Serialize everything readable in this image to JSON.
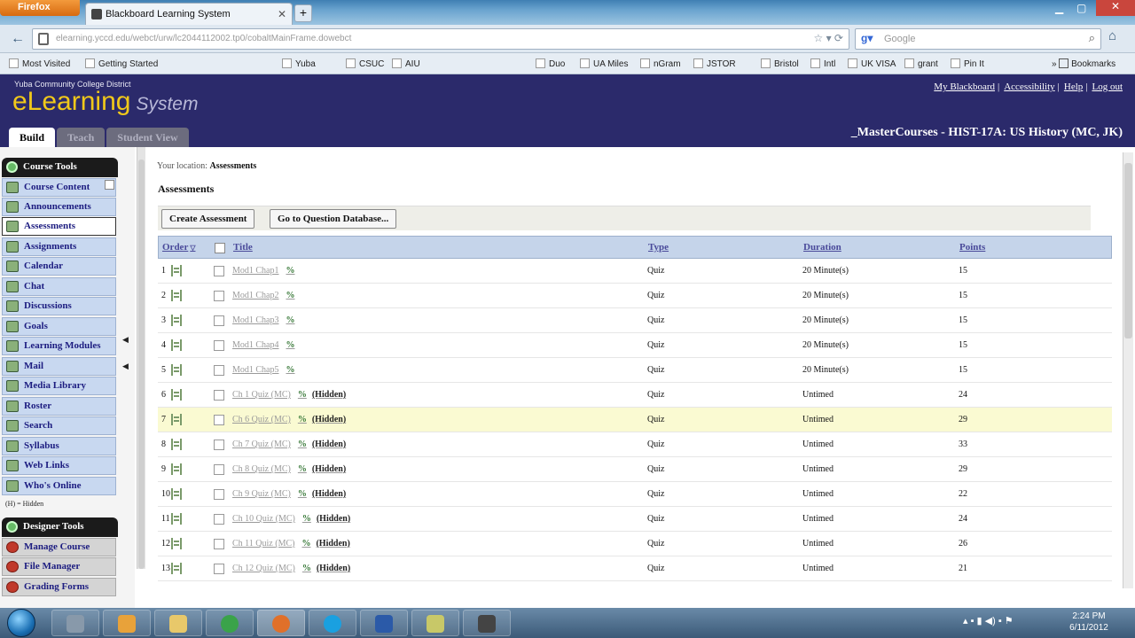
{
  "browser": {
    "firefox_button": "Firefox",
    "tab_title": "Blackboard Learning System",
    "url": "elearning.yccd.edu/webct/urw/lc2044112002.tp0/cobaltMainFrame.dowebct",
    "search_placeholder": "Google",
    "bookmarks": [
      "Most Visited",
      "Getting Started",
      "Yuba",
      "CSUC",
      "AIU",
      "Duo",
      "UA Miles",
      "nGram",
      "JSTOR",
      "Bristol",
      "Intl",
      "UK VISA",
      "grant",
      "Pin It"
    ],
    "bookmarks_menu": "Bookmarks"
  },
  "lms": {
    "district": "Yuba Community College District",
    "logo_main": "eLearning",
    "logo_sub": "System",
    "top_links": [
      "My Blackboard",
      "Accessibility",
      "Help",
      "Log out"
    ],
    "tabs": [
      "Build",
      "Teach",
      "Student View"
    ],
    "active_tab": "Build",
    "course_title": "_MasterCourses - HIST-17A: US History (MC, JK)"
  },
  "sidebar": {
    "course_tools_title": "Course Tools",
    "course_tools": [
      "Course Content",
      "Announcements",
      "Assessments",
      "Assignments",
      "Calendar",
      "Chat",
      "Discussions",
      "Goals",
      "Learning Modules",
      "Mail",
      "Media Library",
      "Roster",
      "Search",
      "Syllabus",
      "Web Links",
      "Who's Online"
    ],
    "active_item": "Assessments",
    "hidden_note": "(H) = Hidden",
    "designer_tools_title": "Designer Tools",
    "designer_tools": [
      "Manage Course",
      "File Manager",
      "Grading Forms"
    ]
  },
  "main": {
    "breadcrumb_prefix": "Your location:",
    "breadcrumb_current": "Assessments",
    "page_title": "Assessments",
    "buttons": {
      "create": "Create Assessment",
      "question_db": "Go to Question Database..."
    },
    "columns": {
      "order": "Order",
      "title": "Title",
      "type": "Type",
      "duration": "Duration",
      "points": "Points"
    },
    "hidden_label": "(Hidden)",
    "rows": [
      {
        "order": "1",
        "title": "Mod1 Chap1",
        "type": "Quiz",
        "duration": "20 Minute(s)",
        "points": "15"
      },
      {
        "order": "2",
        "title": "Mod1 Chap2",
        "type": "Quiz",
        "duration": "20 Minute(s)",
        "points": "15"
      },
      {
        "order": "3",
        "title": "Mod1 Chap3",
        "type": "Quiz",
        "duration": "20 Minute(s)",
        "points": "15"
      },
      {
        "order": "4",
        "title": "Mod1 Chap4",
        "type": "Quiz",
        "duration": "20 Minute(s)",
        "points": "15"
      },
      {
        "order": "5",
        "title": "Mod1 Chap5",
        "type": "Quiz",
        "duration": "20 Minute(s)",
        "points": "15"
      },
      {
        "order": "6",
        "title": "Ch 1 Quiz (MC)",
        "type": "Quiz",
        "duration": "Untimed",
        "points": "24"
      },
      {
        "order": "7",
        "title": "Ch 6 Quiz (MC)",
        "type": "Quiz",
        "duration": "Untimed",
        "points": "29"
      },
      {
        "order": "8",
        "title": "Ch 7 Quiz (MC)",
        "type": "Quiz",
        "duration": "Untimed",
        "points": "33"
      },
      {
        "order": "9",
        "title": "Ch 8 Quiz (MC)",
        "type": "Quiz",
        "duration": "Untimed",
        "points": "29"
      },
      {
        "order": "10",
        "title": "Ch 9 Quiz (MC)",
        "type": "Quiz",
        "duration": "Untimed",
        "points": "22"
      },
      {
        "order": "11",
        "title": "Ch 10 Quiz (MC)",
        "type": "Quiz",
        "duration": "Untimed",
        "points": "24"
      },
      {
        "order": "12",
        "title": "Ch 11 Quiz (MC)",
        "type": "Quiz",
        "duration": "Untimed",
        "points": "26"
      },
      {
        "order": "13",
        "title": "Ch 12 Quiz (MC)",
        "type": "Quiz",
        "duration": "Untimed",
        "points": "21"
      }
    ]
  },
  "taskbar": {
    "time": "2:24 PM",
    "date": "6/11/2012"
  },
  "colors": {
    "header_bg": "#2b2a6b",
    "logo_yellow": "#f0c81a",
    "table_header": "#c5d4ea",
    "row_highlight": "#fafad2"
  }
}
